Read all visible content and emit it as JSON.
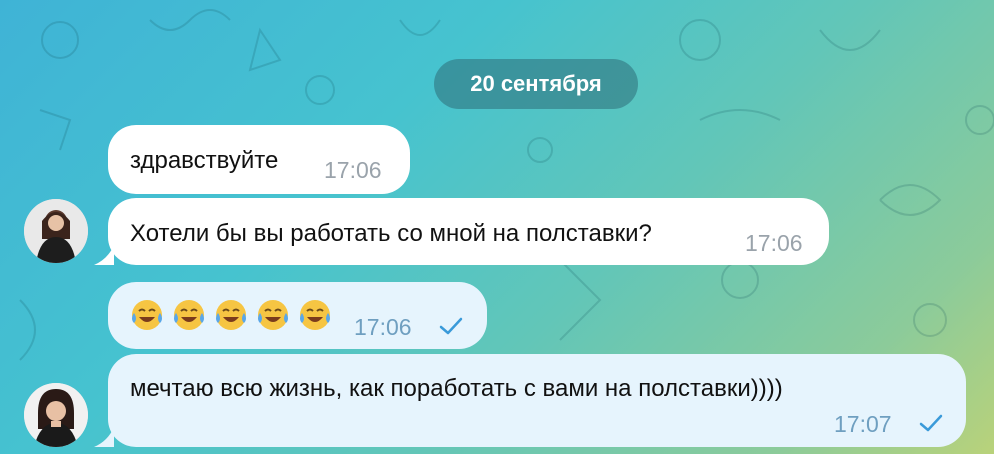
{
  "date_separator": "20 сентября",
  "messages": [
    {
      "text": "здравствуйте",
      "time": "17:06"
    },
    {
      "text": "Хотели бы вы работать со мной на полставки?",
      "time": "17:06"
    },
    {
      "emoji": "😂😂😂😂😂",
      "time": "17:06"
    },
    {
      "text": "мечтаю всю жизнь, как поработать с вами на полставки))))",
      "time": "17:07"
    }
  ],
  "colors": {
    "incoming_bubble": "#ffffff",
    "outgoing_bubble": "#e6f4fd",
    "check": "#3a9ad9"
  }
}
